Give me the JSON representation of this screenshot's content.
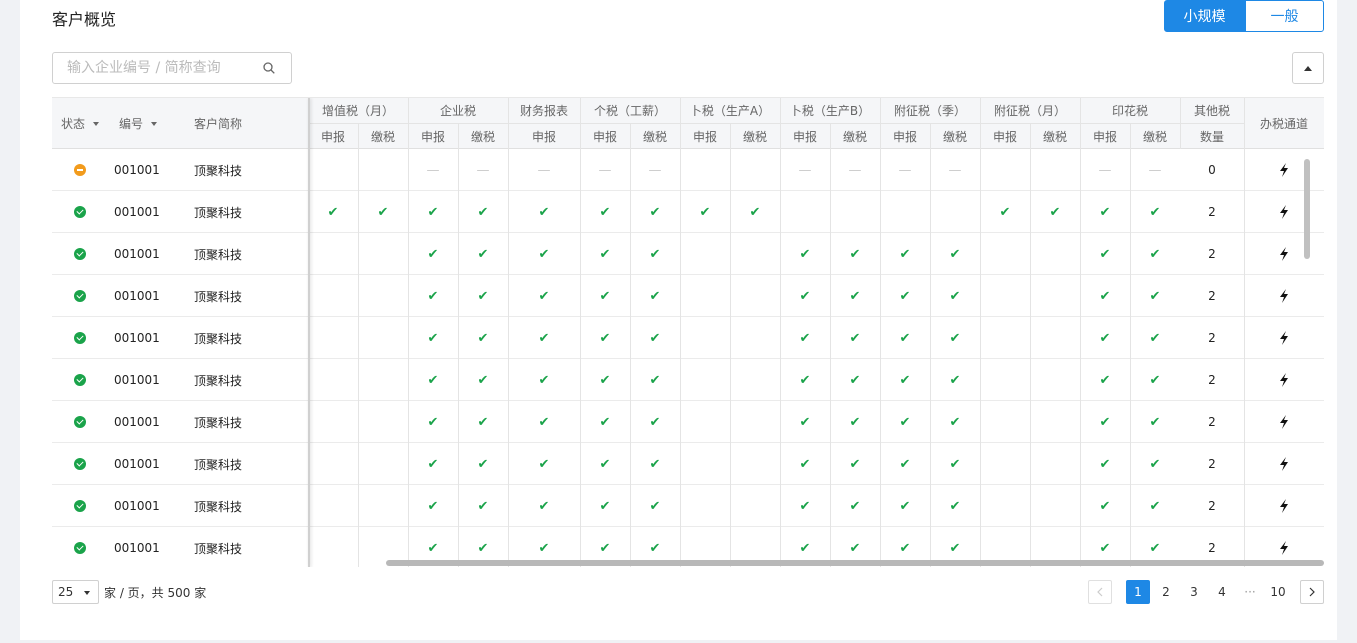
{
  "page": {
    "title": "客户概览"
  },
  "scale_toggle": {
    "small_label": "小规模",
    "general_label": "一般",
    "active": "small"
  },
  "search": {
    "placeholder": "输入企业编号 / 简称查询"
  },
  "table": {
    "fixed_headers": {
      "status": "状态",
      "code": "编号",
      "name": "客户简称"
    },
    "groups": [
      {
        "label": "增值税（月）",
        "subs": [
          "申报",
          "缴税"
        ]
      },
      {
        "label": "企业税",
        "subs": [
          "申报",
          "缴税"
        ]
      },
      {
        "label": "财务报表",
        "subs": [
          "申报"
        ]
      },
      {
        "label": "个税（工薪）",
        "subs": [
          "申报",
          "缴税"
        ]
      },
      {
        "label": "卜税（生产A）",
        "subs": [
          "申报",
          "缴税"
        ]
      },
      {
        "label": "卜税（生产B）",
        "subs": [
          "申报",
          "缴税"
        ]
      },
      {
        "label": "附征税（季）",
        "subs": [
          "申报",
          "缴税"
        ]
      },
      {
        "label": "附征税（月）",
        "subs": [
          "申报",
          "缴税"
        ]
      },
      {
        "label": "印花税",
        "subs": [
          "申报",
          "缴税"
        ]
      },
      {
        "label": "其他税",
        "subs": [
          "数量"
        ]
      }
    ],
    "channel_header": "办税通道",
    "legend": {
      "check": "✔",
      "dash": "—"
    },
    "rows": [
      {
        "status": "warn",
        "code": "001001",
        "name": "顶聚科技",
        "marks": [
          "",
          "",
          "-",
          "-",
          "-",
          "-",
          "-",
          "",
          "",
          "-",
          "-",
          "-",
          "-",
          "",
          "",
          "-",
          "-"
        ],
        "count": "0"
      },
      {
        "status": "ok",
        "code": "001001",
        "name": "顶聚科技",
        "marks": [
          "c",
          "c",
          "c",
          "c",
          "c",
          "c",
          "c",
          "c",
          "c",
          "",
          "",
          "",
          "",
          "c",
          "c",
          "c",
          "c"
        ],
        "count": "2"
      },
      {
        "status": "ok",
        "code": "001001",
        "name": "顶聚科技",
        "marks": [
          "",
          "",
          "c",
          "c",
          "c",
          "c",
          "c",
          "",
          "",
          "c",
          "c",
          "c",
          "c",
          "",
          "",
          "c",
          "c"
        ],
        "count": "2"
      },
      {
        "status": "ok",
        "code": "001001",
        "name": "顶聚科技",
        "marks": [
          "",
          "",
          "c",
          "c",
          "c",
          "c",
          "c",
          "",
          "",
          "c",
          "c",
          "c",
          "c",
          "",
          "",
          "c",
          "c"
        ],
        "count": "2"
      },
      {
        "status": "ok",
        "code": "001001",
        "name": "顶聚科技",
        "marks": [
          "",
          "",
          "c",
          "c",
          "c",
          "c",
          "c",
          "",
          "",
          "c",
          "c",
          "c",
          "c",
          "",
          "",
          "c",
          "c"
        ],
        "count": "2"
      },
      {
        "status": "ok",
        "code": "001001",
        "name": "顶聚科技",
        "marks": [
          "",
          "",
          "c",
          "c",
          "c",
          "c",
          "c",
          "",
          "",
          "c",
          "c",
          "c",
          "c",
          "",
          "",
          "c",
          "c"
        ],
        "count": "2"
      },
      {
        "status": "ok",
        "code": "001001",
        "name": "顶聚科技",
        "marks": [
          "",
          "",
          "c",
          "c",
          "c",
          "c",
          "c",
          "",
          "",
          "c",
          "c",
          "c",
          "c",
          "",
          "",
          "c",
          "c"
        ],
        "count": "2"
      },
      {
        "status": "ok",
        "code": "001001",
        "name": "顶聚科技",
        "marks": [
          "",
          "",
          "c",
          "c",
          "c",
          "c",
          "c",
          "",
          "",
          "c",
          "c",
          "c",
          "c",
          "",
          "",
          "c",
          "c"
        ],
        "count": "2"
      },
      {
        "status": "ok",
        "code": "001001",
        "name": "顶聚科技",
        "marks": [
          "",
          "",
          "c",
          "c",
          "c",
          "c",
          "c",
          "",
          "",
          "c",
          "c",
          "c",
          "c",
          "",
          "",
          "c",
          "c"
        ],
        "count": "2"
      },
      {
        "status": "ok",
        "code": "001001",
        "name": "顶聚科技",
        "marks": [
          "",
          "",
          "c",
          "c",
          "c",
          "c",
          "c",
          "",
          "",
          "c",
          "c",
          "c",
          "c",
          "",
          "",
          "c",
          "c"
        ],
        "count": "2"
      }
    ]
  },
  "pagination": {
    "page_size": "25",
    "summary": "家 / 页，共 500 家",
    "pages": [
      "1",
      "2",
      "3",
      "4"
    ],
    "ellipsis": "···",
    "last_page": "10",
    "current": "1",
    "prev_icon": "chevron-left-icon",
    "next_icon": "chevron-right-icon"
  },
  "colors": {
    "primary": "#1e88e5",
    "ok": "#1aa34a",
    "warn": "#f29b1c"
  }
}
